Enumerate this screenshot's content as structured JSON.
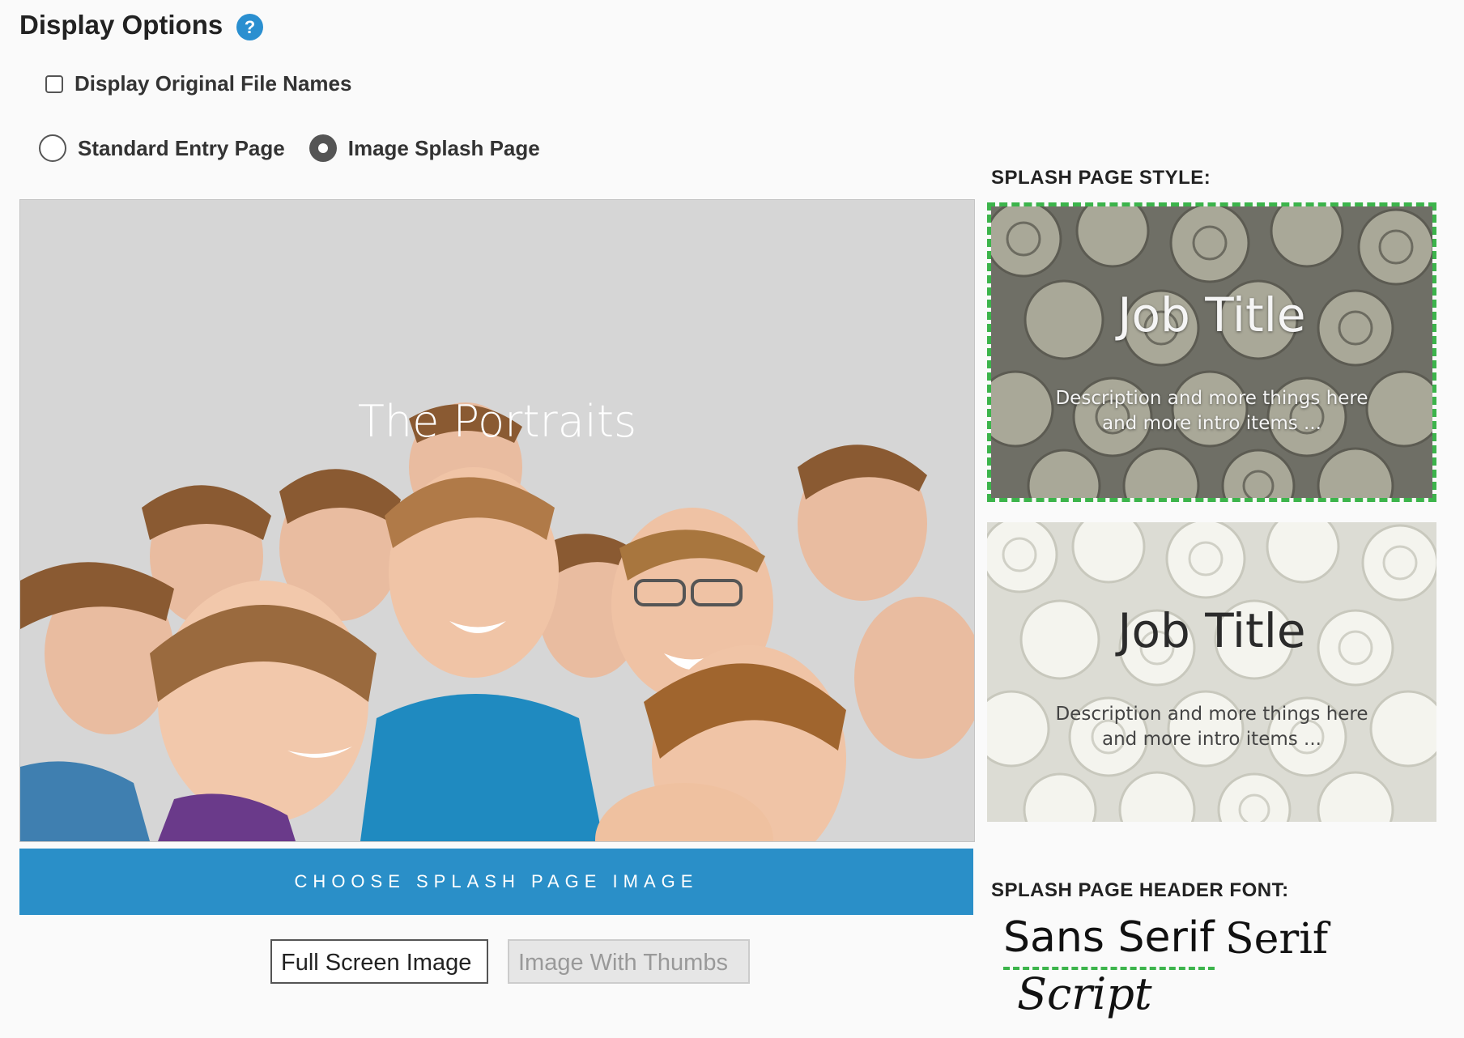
{
  "header": {
    "title": "Display Options",
    "help_icon": "?"
  },
  "options": {
    "display_original_file_names": {
      "label": "Display Original File Names",
      "checked": false
    },
    "entry_type": [
      {
        "label": "Standard Entry Page",
        "selected": false
      },
      {
        "label": "Image Splash Page",
        "selected": true
      }
    ]
  },
  "preview": {
    "title": "The Portraits"
  },
  "choose_button": {
    "label": "CHOOSE SPLASH PAGE IMAGE"
  },
  "modes": {
    "full_screen": {
      "label": "Full Screen Image",
      "active": true
    },
    "with_thumbs": {
      "label": "Image With Thumbs",
      "active": false
    }
  },
  "style_section": {
    "label": "SPLASH PAGE STYLE:",
    "cards": [
      {
        "title": "Job Title",
        "desc_line1": "Description and more things here",
        "desc_line2": "and more intro items ...",
        "selected": true
      },
      {
        "title": "Job Title",
        "desc_line1": "Description and more things here",
        "desc_line2": "and more intro items ...",
        "selected": false
      }
    ]
  },
  "font_section": {
    "label": "SPLASH PAGE HEADER FONT:",
    "options": [
      "Sans Serif",
      "Serif",
      "Script"
    ],
    "selected": "Sans Serif"
  },
  "colors": {
    "accent_blue": "#2a8fc8",
    "selected_green": "#3cb44b"
  }
}
